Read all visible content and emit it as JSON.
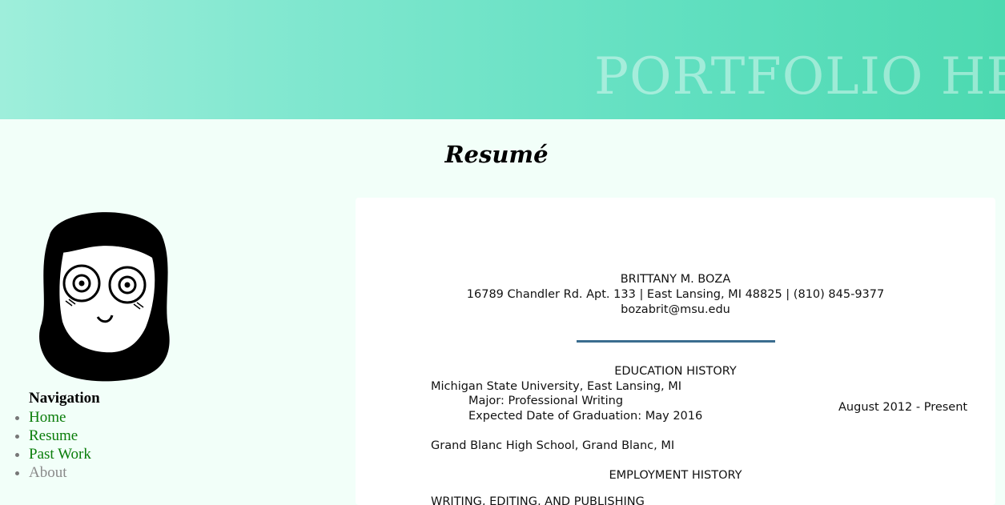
{
  "header": {
    "title": "PORTFOLIO HE"
  },
  "page": {
    "title": "Resumé"
  },
  "nav": {
    "heading": "Navigation",
    "items": [
      {
        "label": "Home"
      },
      {
        "label": "Resume"
      },
      {
        "label": "Past Work"
      },
      {
        "label": "About"
      }
    ]
  },
  "resume": {
    "name": "BRITTANY M. BOZA",
    "address": "16789 Chandler Rd. Apt. 133 | East Lansing, MI 48825 | (810) 845-9377",
    "email": "bozabrit@msu.edu",
    "education_heading": "EDUCATION HISTORY",
    "school1": "Michigan State University, East Lansing, MI",
    "major": "Major: Professional Writing",
    "graduation": "Expected Date of Graduation: May 2016",
    "date_range": "August 2012 - Present",
    "school2": "Grand Blanc High School, Grand Blanc, MI",
    "employment_heading": "EMPLOYMENT HISTORY",
    "job1": "WRITING, EDITING, AND PUBLISHING"
  }
}
